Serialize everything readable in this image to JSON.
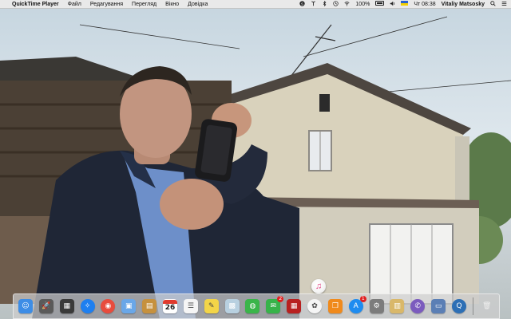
{
  "menubar": {
    "apple_icon": "",
    "app_name": "QuickTime Player",
    "menus": [
      "Файл",
      "Редагування",
      "Перегляд",
      "Вікно",
      "Довідка"
    ],
    "status": {
      "battery_percent": "100%",
      "clock": "Чт 08:38",
      "user": "Vitaliy Matsosky"
    }
  },
  "dock": {
    "apps": [
      {
        "name": "finder-icon",
        "glyph": "☺",
        "color": "#3d8de6"
      },
      {
        "name": "launchpad-icon",
        "glyph": "🚀",
        "color": "#5a5a5a"
      },
      {
        "name": "mission-control-icon",
        "glyph": "▦",
        "color": "#3a3a3a"
      },
      {
        "name": "safari-icon",
        "glyph": "✧",
        "color": "#1e7ff0"
      },
      {
        "name": "chrome-icon",
        "glyph": "◉",
        "color": "#e84c3d"
      },
      {
        "name": "preview-icon",
        "glyph": "▣",
        "color": "#6aa7e8"
      },
      {
        "name": "contacts-icon",
        "glyph": "▤",
        "color": "#c6913e"
      },
      {
        "name": "calendar-icon",
        "glyph": "",
        "color": "#ffffff",
        "day": "26"
      },
      {
        "name": "reminders-icon",
        "glyph": "☰",
        "color": "#f5f5f5"
      },
      {
        "name": "notes-icon",
        "glyph": "✎",
        "color": "#f3d548"
      },
      {
        "name": "photos-folder-icon",
        "glyph": "▩",
        "color": "#b8d0e0"
      },
      {
        "name": "facetime-icon",
        "glyph": "◍",
        "color": "#3ab54a"
      },
      {
        "name": "messages-icon",
        "glyph": "✉",
        "color": "#37b34a",
        "badge": "2"
      },
      {
        "name": "photo-booth-icon",
        "glyph": "▦",
        "color": "#b82020"
      },
      {
        "name": "photos-icon",
        "glyph": "✿",
        "color": "#f5f5f5"
      },
      {
        "name": "ibooks-icon",
        "glyph": "❒",
        "color": "#f08a1c"
      },
      {
        "name": "app-store-icon",
        "glyph": "A",
        "color": "#1e8cf0",
        "badge": "1"
      },
      {
        "name": "system-preferences-icon",
        "glyph": "⚙",
        "color": "#7c7c7c"
      },
      {
        "name": "archive-utility-icon",
        "glyph": "▥",
        "color": "#d9b86a"
      },
      {
        "name": "viber-icon",
        "glyph": "✆",
        "color": "#7b5bbe"
      },
      {
        "name": "screenshot-icon",
        "glyph": "▭",
        "color": "#5b7fb5"
      },
      {
        "name": "quicktime-icon",
        "glyph": "Q",
        "color": "#2d6fb5"
      }
    ],
    "trash_icon": "🗑",
    "floating_itunes_icon": "♫"
  }
}
